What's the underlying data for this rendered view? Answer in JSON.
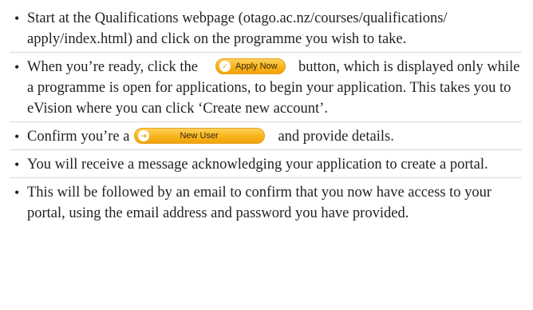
{
  "steps": [
    {
      "text": "Start at the Qualifications webpage (otago.ac.nz/courses/qualifications/ apply/index.html) and click on the programme you wish to take."
    },
    {
      "before": "When you’re ready, click the",
      "button_label": "Apply Now",
      "after": "button, which is displayed only while a programme is open for applications, to begin your application. This takes you to eVision where you can click ‘Create new account’."
    },
    {
      "before": "Confirm you’re a",
      "button_label": "New User",
      "after": "and provide details."
    },
    {
      "text": "You will receive a message acknowledging your application to create a portal."
    },
    {
      "text": "This will be followed by an email to confirm that you now have access to your portal, using the email address and password you have provided."
    }
  ],
  "bullet": "•",
  "colors": {
    "button_fill": "#f8b41b",
    "text": "#231f20",
    "divider": "#dcd7d2"
  },
  "icons": {
    "apply_now": "check-circle-icon",
    "new_user": "arrow-right-circle-icon"
  }
}
